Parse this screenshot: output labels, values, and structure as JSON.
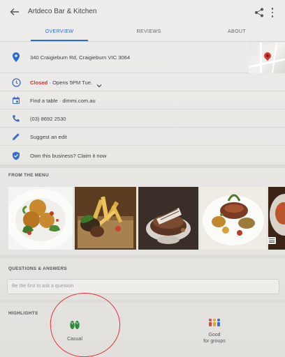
{
  "header": {
    "title": "Artdeco Bar & Kitchen",
    "back_icon": "arrow-left-icon",
    "share_icon": "share-icon",
    "more_icon": "more-vert-icon"
  },
  "tabs": [
    {
      "label": "OVERVIEW",
      "active": true
    },
    {
      "label": "REVIEWS",
      "active": false
    },
    {
      "label": "ABOUT",
      "active": false
    }
  ],
  "info": {
    "address": "340 Craigieburn Rd, Craigieburn VIC 3064",
    "hours_status": "Closed",
    "hours_detail": "· Opens 5PM Tue.",
    "reservation": "Find a table · dimmi.com.au",
    "phone": "(03) 8692 2530",
    "suggest_edit": "Suggest an edit",
    "claim": "Own this business? Claim it now"
  },
  "menu": {
    "section_title": "FROM THE MENU",
    "photos": [
      "Arancini with salad",
      "Chips with skewers on board",
      "Chocolate dessert cup",
      "Steak with vegetables",
      "Partial dish"
    ]
  },
  "qa": {
    "section_title": "QUESTIONS & ANSWERS",
    "placeholder": "Be the first to ask a question"
  },
  "highlights": {
    "section_title": "HIGHLIGHTS",
    "items": [
      {
        "label": "Casual",
        "icon": "flip-flops-icon"
      },
      {
        "label_line1": "Good",
        "label_line2": "for groups",
        "icon": "group-icon"
      }
    ]
  },
  "colors": {
    "accent": "#2a6bd8",
    "closed": "#d0352e",
    "annotation": "#e2323a"
  }
}
